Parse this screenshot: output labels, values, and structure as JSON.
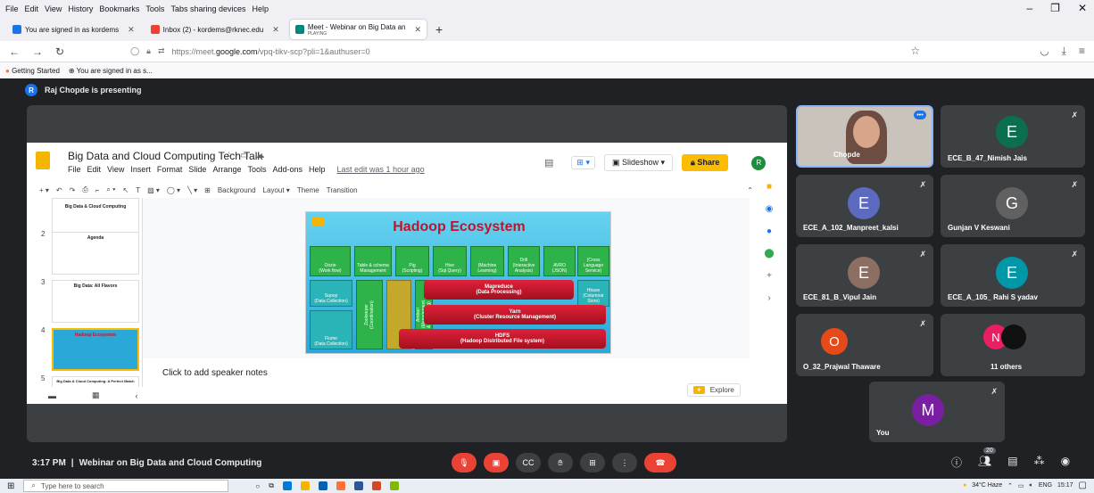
{
  "browser": {
    "menu": [
      "File",
      "Edit",
      "View",
      "History",
      "Bookmarks",
      "Tools",
      "Tabs sharing devices",
      "Help"
    ],
    "tabs": [
      {
        "label": "You are signed in as kordems",
        "color": "#1a73e8"
      },
      {
        "label": "Inbox (2) - kordems@rknec.edu",
        "color": "#ea4335"
      },
      {
        "label": "Meet - Webinar on Big Data an",
        "sub": "PLAYING",
        "color": "#00897b"
      }
    ],
    "url_pre": "https://meet.",
    "url_host": "google.com",
    "url_post": "/vpq-tikv-scp?pli=1&authuser=0",
    "bookmarks": [
      "Getting Started",
      "You are signed in as s..."
    ]
  },
  "meet": {
    "presenting": "Raj Chopde is presenting",
    "presenter_initial": "R",
    "time": "3:17 PM",
    "meeting_title": "Webinar on Big Data and Cloud Computing",
    "participants_count": "20",
    "tiles": [
      {
        "name": "Chopde",
        "initial": "",
        "color": ""
      },
      {
        "name": "ECE_B_47_Nimish Jais",
        "initial": "E",
        "color": "#0b6e4f"
      },
      {
        "name": "ECE_A_102_Manpreet_kalsi",
        "initial": "E",
        "color": "#5c6bc0"
      },
      {
        "name": "Gunjan V Keswani",
        "initial": "G",
        "color": "#616161"
      },
      {
        "name": "ECE_81_B_Vipul Jain",
        "initial": "E",
        "color": "#8d6e63"
      },
      {
        "name": "ECE_A_105_ Rahi S yadav",
        "initial": "E",
        "color": "#0097a7"
      },
      {
        "name": "O_32_Prajwal Thaware",
        "initial": "O",
        "color": "#e64a19"
      },
      {
        "name": "11 others",
        "initial": "N",
        "color": "#e91e63"
      },
      {
        "name": "You",
        "initial": "M",
        "color": "#7b1fa2"
      }
    ]
  },
  "slides": {
    "doc_title": "Big Data and Cloud Computing Tech Talk",
    "menu": [
      "File",
      "Edit",
      "View",
      "Insert",
      "Format",
      "Slide",
      "Arrange",
      "Tools",
      "Add-ons",
      "Help"
    ],
    "last_edit": "Last edit was 1 hour ago",
    "slideshow_label": "Slideshow",
    "share_label": "Share",
    "user_initial": "R",
    "toolbar": [
      "Background",
      "Layout",
      "Theme",
      "Transition"
    ],
    "speaker_notes": "Click to add speaker notes",
    "explore_label": "Explore",
    "thumb_numbers": [
      "2",
      "3",
      "4",
      "5"
    ],
    "thumb_titles": [
      "Big Data & Cloud Computing",
      "Agenda",
      "Big Data: All Flavors",
      "Hadoop Ecosystem",
      "Big Data & Cloud Computing: A Perfect Match"
    ],
    "slide": {
      "title": "Hadoop Ecosystem",
      "oozie": "Oozie\n(Work flow)",
      "hcatalog": "Table & schema\nManagement",
      "pig": "Pig\n(Scripting)",
      "hive": "Hive\n(Sql Query)",
      "mahout": "(Machine\nLearning)",
      "drill": "Drill\n(Interactive\nAnalysis)",
      "avro": "AVRO\n(JSON)",
      "thrift": "(Cross\nLanguage\nService)",
      "hbase": "Hbase\n(Columnar\nStore)",
      "sqoop": "Sqoop\n(Data Collection)",
      "flume": "Flume\n(Data Collection)",
      "zookeeper": "Zookeeper\n(Coordination)",
      "ambari": "Ambari\n(Management\n& Monitoring)",
      "mapreduce": "Mapreduce",
      "mapreduce_sub": "(Data Processing)",
      "yarn": "Yarn",
      "yarn_sub": "(Cluster Resource Management)",
      "hdfs": "HDFS",
      "hdfs_sub": "(Hadoop Distributed File system)"
    }
  },
  "taskbar": {
    "search_placeholder": "Type here to search",
    "weather": "34°C Haze",
    "lang": "ENG",
    "clock": "15:17"
  }
}
